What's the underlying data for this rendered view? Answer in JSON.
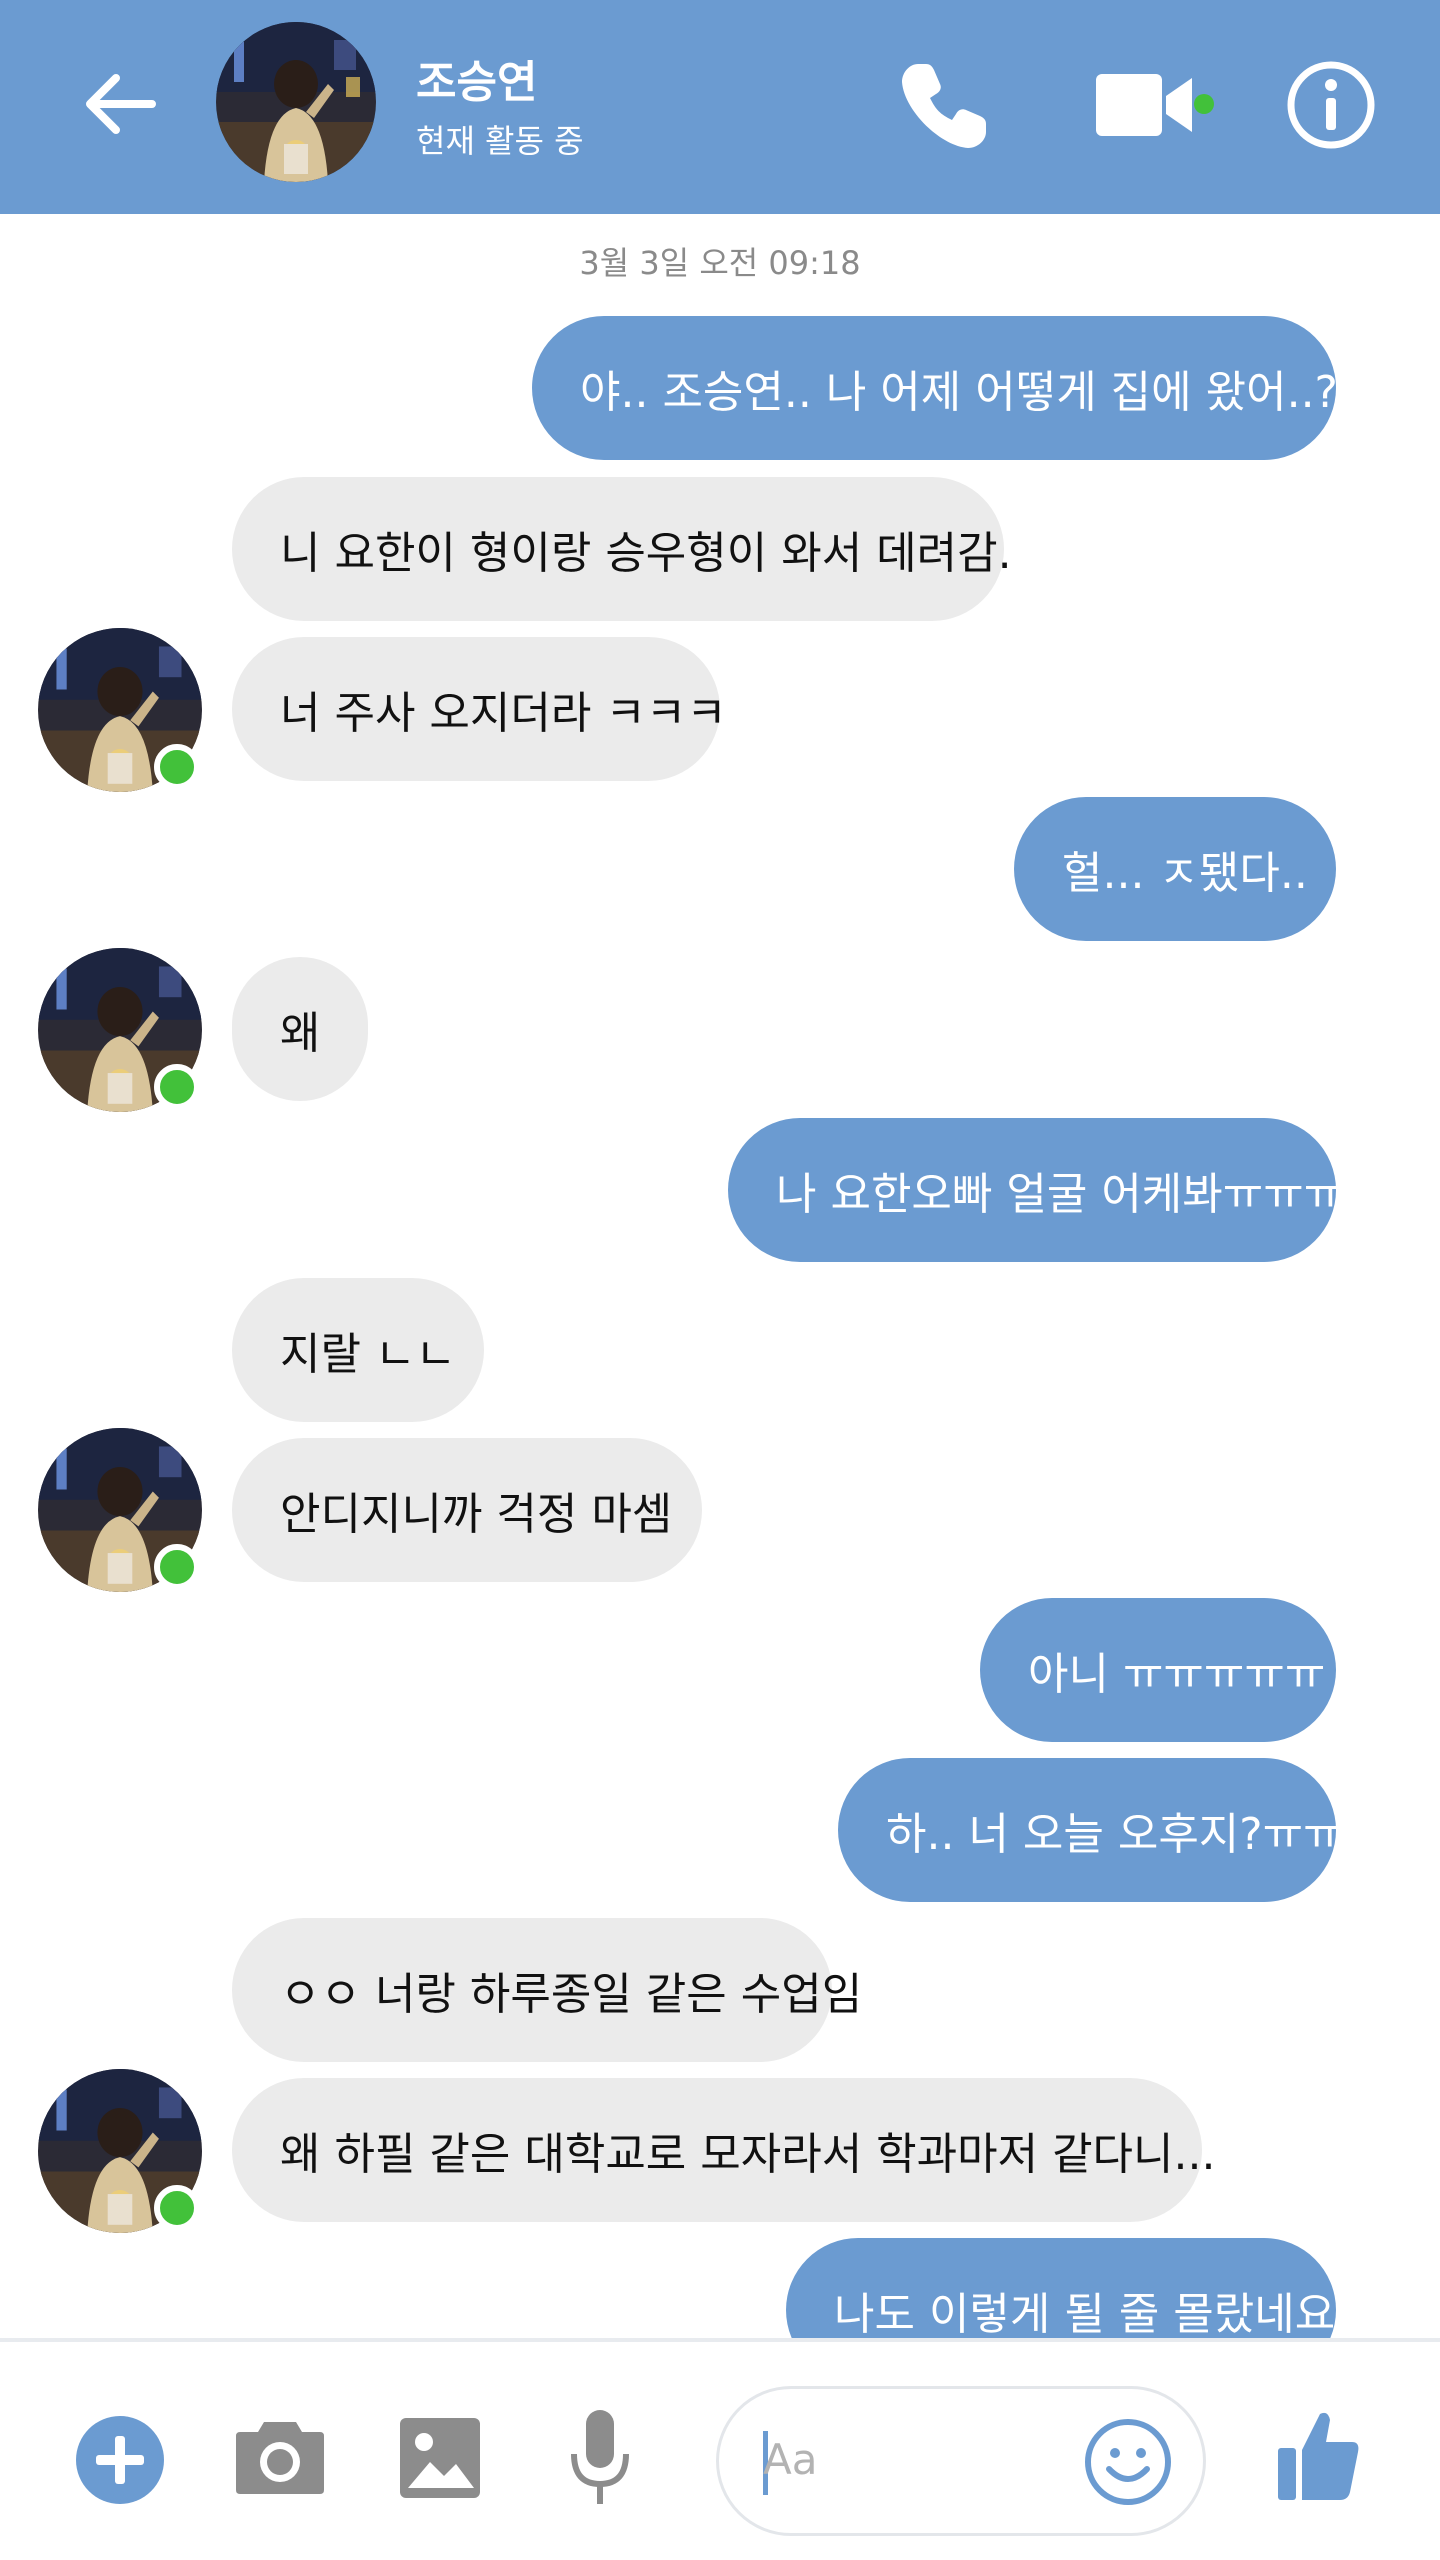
{
  "header": {
    "back_icon": "arrow-left-icon",
    "contact_name": "조승연",
    "status": "현재 활동 중",
    "call_icon": "phone-icon",
    "video_icon": "video-camera-icon",
    "info_icon": "info-icon"
  },
  "thread": {
    "timestamp": "3월 3일 오전 09:18",
    "messages": [
      {
        "from": "me",
        "text": "야.. 조승연.. 나 어제 어떻게 집에 왔어..?"
      },
      {
        "from": "contact",
        "text": "니 요한이 형이랑 승우형이 와서 데려감."
      },
      {
        "from": "contact",
        "text": "너 주사 오지더라 ㅋㅋㅋ"
      },
      {
        "from": "me",
        "text": "헐... ㅈ됐다.."
      },
      {
        "from": "contact",
        "text": "왜"
      },
      {
        "from": "me",
        "text": "나 요한오빠 얼굴 어케봐ㅠㅠㅠ"
      },
      {
        "from": "contact",
        "text": "지랄 ㄴㄴ"
      },
      {
        "from": "contact",
        "text": "안디지니까 걱정 마셈"
      },
      {
        "from": "me",
        "text": "아니 ㅠㅠㅠㅠㅠ"
      },
      {
        "from": "me",
        "text": "하.. 너 오늘 오후지?ㅠㅠ"
      },
      {
        "from": "contact",
        "text": "ㅇㅇ 너랑 하루종일 같은 수업임"
      },
      {
        "from": "contact",
        "text": "왜 하필 같은 대학교로 모자라서 학과마저 같다니..."
      },
      {
        "from": "me",
        "text": "나도 이렇게 될 줄 몰랐네요"
      }
    ]
  },
  "composer": {
    "placeholder": "Aa",
    "tools": [
      "plus-circle-icon",
      "camera-icon",
      "image-icon",
      "microphone-icon"
    ],
    "emoji_icon": "smiley-icon",
    "like_icon": "thumbs-up-icon"
  },
  "colors": {
    "accent": "#6b9bd1",
    "incoming_bubble": "#ebebeb",
    "online": "#42c13a",
    "timestamp": "#8a8a8a"
  }
}
